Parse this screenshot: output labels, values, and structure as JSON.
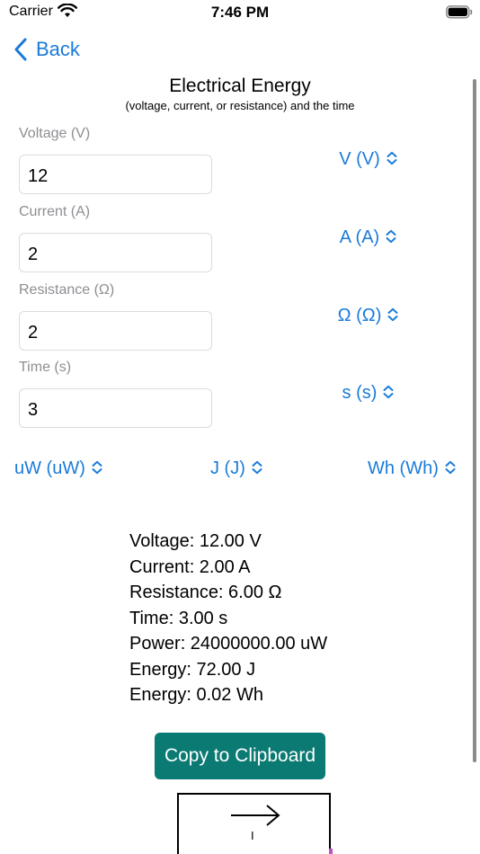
{
  "status_bar": {
    "carrier": "Carrier",
    "time": "7:46 PM"
  },
  "nav": {
    "back_label": "Back"
  },
  "header": {
    "title": "Electrical Energy",
    "subtitle": "(voltage, current, or resistance) and the time"
  },
  "inputs": [
    {
      "label": "Voltage (V)",
      "value": "12",
      "unit": "V (V)"
    },
    {
      "label": "Current (A)",
      "value": "2",
      "unit": "A (A)"
    },
    {
      "label": "Resistance (Ω)",
      "value": "2",
      "unit": "Ω (Ω)"
    },
    {
      "label": "Time (s)",
      "value": "3",
      "unit": "s (s)"
    }
  ],
  "output_units": {
    "power": "uW (uW)",
    "energy_j": "J (J)",
    "energy_wh": "Wh (Wh)"
  },
  "results": [
    "Voltage: 12.00 V",
    "Current: 2.00 A",
    "Resistance: 6.00 Ω",
    "Time: 3.00 s",
    "Power: 24000000.00 uW",
    "Energy: 72.00 J",
    "Energy: 0.02 Wh"
  ],
  "copy_button_label": "Copy to Clipboard",
  "diagram": {
    "current_symbol": "I"
  },
  "colors": {
    "accent": "#1a7bd9",
    "button": "#0a7a72",
    "label_gray": "#8e8e93"
  },
  "icons": [
    "wifi-icon",
    "battery-icon",
    "back-chevron-icon",
    "updown-chevron-icon",
    "arrow-right-icon"
  ]
}
